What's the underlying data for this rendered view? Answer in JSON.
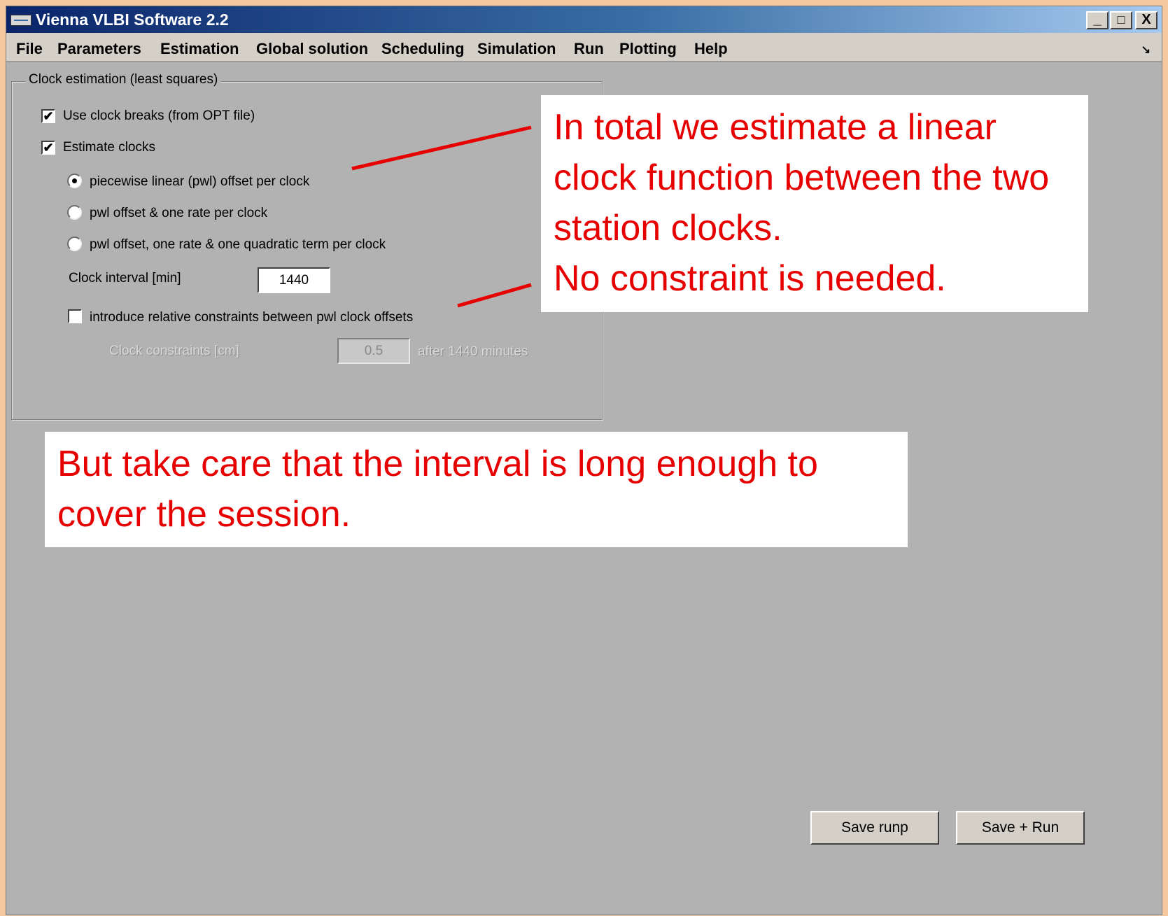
{
  "window": {
    "title": "Vienna VLBI Software 2.2"
  },
  "window_controls": {
    "minimize": "_",
    "maximize": "□",
    "close": "X"
  },
  "menu": [
    "File",
    "Parameters",
    "Estimation",
    "Global solution",
    "Scheduling",
    "Simulation",
    "Run",
    "Plotting",
    "Help"
  ],
  "menu_arrow": "↘",
  "panel": {
    "title": "Clock estimation (least squares)",
    "use_clock_breaks": {
      "label": "Use clock breaks (from OPT file)",
      "checked": true
    },
    "estimate_clocks": {
      "label": "Estimate clocks",
      "checked": true
    },
    "options": [
      {
        "label": "piecewise linear (pwl) offset per clock",
        "selected": true
      },
      {
        "label": "pwl offset & one rate per clock",
        "selected": false
      },
      {
        "label": "pwl offset, one rate & one quadratic term per clock",
        "selected": false
      }
    ],
    "clock_interval": {
      "label": "Clock interval [min]",
      "value": "1440"
    },
    "relative_constraints": {
      "label": "introduce relative constraints between pwl clock offsets",
      "checked": false
    },
    "clock_constraints": {
      "label": "Clock constraints [cm]",
      "value": "0.5",
      "suffix": "after 1440 minutes"
    }
  },
  "annotations": {
    "note1": "In total we estimate a linear clock function between the two station clocks.\nNo constraint is needed.",
    "note2": "But take care that the interval is long enough to cover the session.",
    "color": "#e60000"
  },
  "buttons": {
    "save_runp": "Save runp",
    "save_run": "Save + Run"
  }
}
